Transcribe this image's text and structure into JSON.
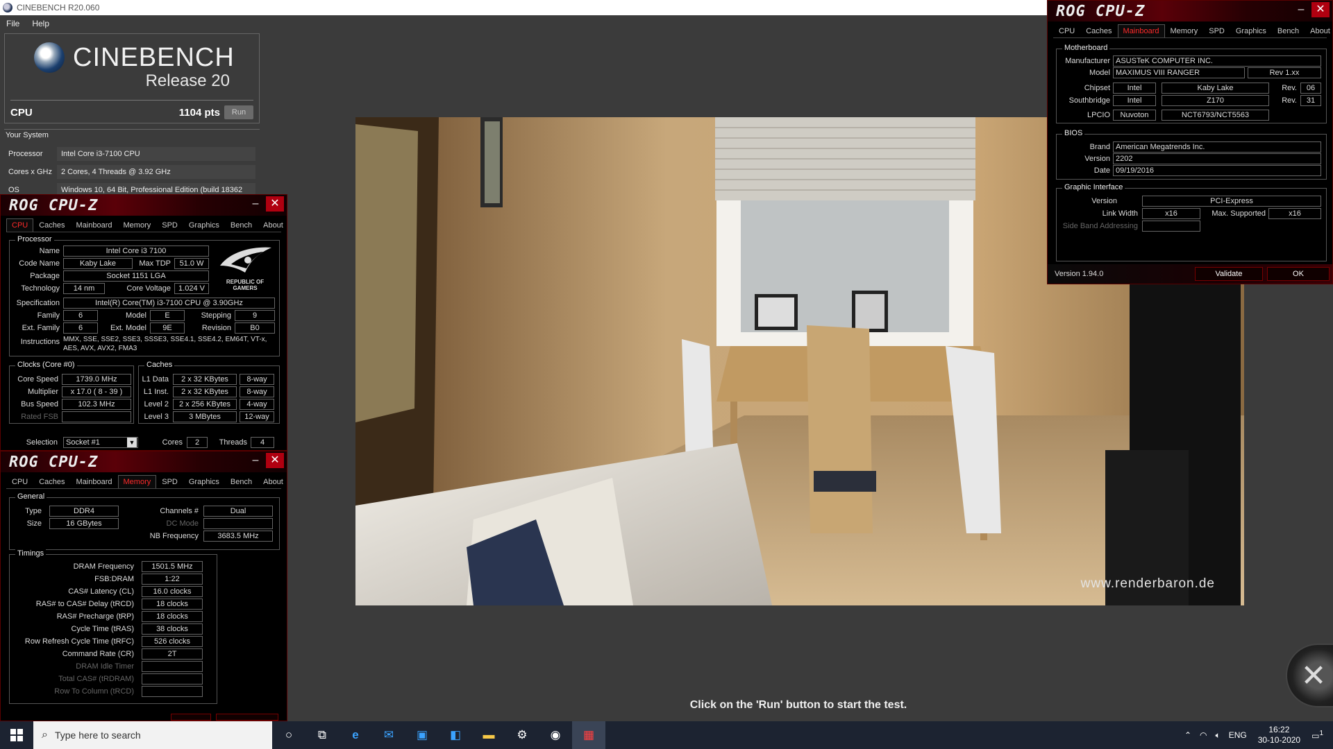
{
  "cinebench": {
    "window_title": "CINEBENCH R20.060",
    "menu": [
      "File",
      "Help"
    ],
    "brand": "CINEBENCH",
    "release": "Release 20",
    "cpu_label": "CPU",
    "score": "1104 pts",
    "run_button": "Run",
    "your_system": {
      "title": "Your System",
      "rows": [
        {
          "label": "Processor",
          "value": "Intel Core i3-7100 CPU"
        },
        {
          "label": "Cores x GHz",
          "value": "2 Cores, 4 Threads @ 3.92 GHz"
        },
        {
          "label": "OS",
          "value": "Windows 10, 64 Bit, Professional Edition (build 18362"
        }
      ]
    },
    "watermark": "www.renderbaron.de",
    "status_message": "Click on the 'Run' button to start the test."
  },
  "cpuz_common": {
    "brand": "ROG CPU-Z",
    "tabs": [
      "CPU",
      "Caches",
      "Mainboard",
      "Memory",
      "SPD",
      "Graphics",
      "Bench",
      "About"
    ]
  },
  "cpuz_cpu": {
    "processor_legend": "Processor",
    "name_label": "Name",
    "name": "Intel Core i3 7100",
    "codename_label": "Code Name",
    "codename": "Kaby Lake",
    "maxtdp_label": "Max TDP",
    "maxtdp": "51.0 W",
    "package_label": "Package",
    "package": "Socket 1151 LGA",
    "technology_label": "Technology",
    "technology": "14 nm",
    "corevoltage_label": "Core Voltage",
    "corevoltage": "1.024 V",
    "spec_label": "Specification",
    "spec": "Intel(R) Core(TM) i3-7100 CPU @ 3.90GHz",
    "family_label": "Family",
    "family": "6",
    "model_label": "Model",
    "model": "E",
    "stepping_label": "Stepping",
    "stepping": "9",
    "extfamily_label": "Ext. Family",
    "extfamily": "6",
    "extmodel_label": "Ext. Model",
    "extmodel": "9E",
    "revision_label": "Revision",
    "revision": "B0",
    "instructions_label": "Instructions",
    "instructions_1": "MMX, SSE, SSE2, SSE3, SSSE3, SSE4.1, SSE4.2, EM64T, VT-x,",
    "instructions_2": "AES, AVX, AVX2, FMA3",
    "clocks_legend": "Clocks (Core #0)",
    "corespeed_label": "Core Speed",
    "corespeed": "1739.0 MHz",
    "multiplier_label": "Multiplier",
    "multiplier": "x 17.0 ( 8 - 39 )",
    "busspeed_label": "Bus Speed",
    "busspeed": "102.3 MHz",
    "ratedfsb_label": "Rated FSB",
    "caches_legend": "Caches",
    "l1data_label": "L1 Data",
    "l1data": "2 x 32 KBytes",
    "l1data_way": "8-way",
    "l1inst_label": "L1 Inst.",
    "l1inst": "2 x 32 KBytes",
    "l1inst_way": "8-way",
    "l2_label": "Level 2",
    "l2": "2 x 256 KBytes",
    "l2_way": "4-way",
    "l3_label": "Level 3",
    "l3": "3 MBytes",
    "l3_way": "12-way",
    "selection_label": "Selection",
    "selection": "Socket #1",
    "cores_label": "Cores",
    "cores": "2",
    "threads_label": "Threads",
    "threads": "4",
    "rog_text": "REPUBLIC OF GAMERS"
  },
  "cpuz_mem": {
    "general_legend": "General",
    "type_label": "Type",
    "type": "DDR4",
    "size_label": "Size",
    "size": "16 GBytes",
    "channels_label": "Channels #",
    "channels": "Dual",
    "dcmode_label": "DC Mode",
    "nbfreq_label": "NB Frequency",
    "nbfreq": "3683.5 MHz",
    "timings_legend": "Timings",
    "timings": [
      {
        "label": "DRAM Frequency",
        "value": "1501.5 MHz"
      },
      {
        "label": "FSB:DRAM",
        "value": "1:22"
      },
      {
        "label": "CAS# Latency (CL)",
        "value": "16.0 clocks"
      },
      {
        "label": "RAS# to CAS# Delay (tRCD)",
        "value": "18 clocks"
      },
      {
        "label": "RAS# Precharge (tRP)",
        "value": "18 clocks"
      },
      {
        "label": "Cycle Time (tRAS)",
        "value": "38 clocks"
      },
      {
        "label": "Row Refresh Cycle Time (tRFC)",
        "value": "526 clocks"
      },
      {
        "label": "Command Rate (CR)",
        "value": "2T"
      },
      {
        "label": "DRAM Idle Timer",
        "value": ""
      },
      {
        "label": "Total CAS# (tRDRAM)",
        "value": ""
      },
      {
        "label": "Row To Column (tRCD)",
        "value": ""
      }
    ]
  },
  "cpuz_mb": {
    "motherboard_legend": "Motherboard",
    "manufacturer_label": "Manufacturer",
    "manufacturer": "ASUSTeK COMPUTER INC.",
    "model_label": "Model",
    "model": "MAXIMUS VIII RANGER",
    "model_rev": "Rev 1.xx",
    "chipset_label": "Chipset",
    "chipset_vendor": "Intel",
    "chipset": "Kaby Lake",
    "chipset_rev_label": "Rev.",
    "chipset_rev": "06",
    "southbridge_label": "Southbridge",
    "sb_vendor": "Intel",
    "sb": "Z170",
    "sb_rev_label": "Rev.",
    "sb_rev": "31",
    "lpcio_label": "LPCIO",
    "lpcio_vendor": "Nuvoton",
    "lpcio": "NCT6793/NCT5563",
    "bios_legend": "BIOS",
    "brand_label": "Brand",
    "brand": "American Megatrends Inc.",
    "version_label": "Version",
    "version": "2202",
    "date_label": "Date",
    "date": "09/19/2016",
    "gi_legend": "Graphic Interface",
    "gi_version_label": "Version",
    "gi_version": "PCI-Express",
    "linkwidth_label": "Link Width",
    "linkwidth": "x16",
    "maxsupported_label": "Max. Supported",
    "maxsupported": "x16",
    "sideband_label": "Side Band Addressing",
    "app_version": "Version 1.94.0",
    "validate_button": "Validate",
    "ok_button": "OK"
  },
  "taskbar": {
    "search_placeholder": "Type here to search",
    "language": "ENG",
    "time": "16:22",
    "date": "30-10-2020",
    "notification_count": "1"
  },
  "colors": {
    "accent_red": "#ff2a2a",
    "cpuz_close": "#b00010",
    "cinebench_bg": "#3b3b3b",
    "taskbar_bg": "#1c2331"
  }
}
